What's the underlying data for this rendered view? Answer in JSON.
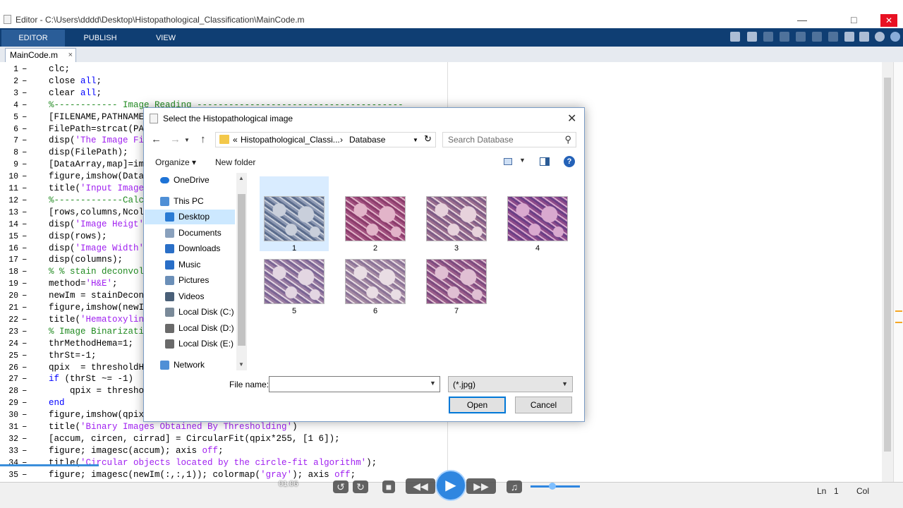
{
  "window": {
    "title": "Editor - C:\\Users\\dddd\\Desktop\\Histopathological_Classification\\MainCode.m"
  },
  "ribbon": {
    "tabs": [
      {
        "label": "EDITOR",
        "active": true
      },
      {
        "label": "PUBLISH",
        "active": false
      },
      {
        "label": "VIEW",
        "active": false
      }
    ]
  },
  "editor": {
    "file_tab": "MainCode.m",
    "lines": [
      {
        "n": "1",
        "parts": [
          [
            "clc;",
            "p"
          ]
        ]
      },
      {
        "n": "2",
        "parts": [
          [
            "close ",
            "p"
          ],
          [
            "all",
            "kw"
          ],
          [
            ";",
            "p"
          ]
        ]
      },
      {
        "n": "3",
        "parts": [
          [
            "clear ",
            "p"
          ],
          [
            "all",
            "kw"
          ],
          [
            ";",
            "p"
          ]
        ]
      },
      {
        "n": "4",
        "parts": [
          [
            "%------------ Image Reading ---------------------------------------",
            "cm"
          ]
        ]
      },
      {
        "n": "5",
        "parts": [
          [
            "[FILENAME,PATHNAME",
            "p"
          ]
        ]
      },
      {
        "n": "6",
        "parts": [
          [
            "FilePath=strcat(PA",
            "p"
          ]
        ]
      },
      {
        "n": "7",
        "parts": [
          [
            "disp(",
            "p"
          ],
          [
            "'The Image Fi",
            "str"
          ]
        ]
      },
      {
        "n": "8",
        "parts": [
          [
            "disp(FilePath);",
            "p"
          ]
        ]
      },
      {
        "n": "9",
        "parts": [
          [
            "[DataArray,map]=im",
            "p"
          ]
        ]
      },
      {
        "n": "10",
        "parts": [
          [
            "figure,imshow(Data",
            "p"
          ]
        ]
      },
      {
        "n": "11",
        "parts": [
          [
            "title(",
            "p"
          ],
          [
            "'Input Image",
            "str"
          ]
        ]
      },
      {
        "n": "12",
        "parts": [
          [
            "%-------------Calc",
            "cm"
          ]
        ]
      },
      {
        "n": "13",
        "parts": [
          [
            "[rows,columns,Ncol",
            "p"
          ]
        ]
      },
      {
        "n": "14",
        "parts": [
          [
            "disp(",
            "p"
          ],
          [
            "'Image Heigt'",
            "str"
          ]
        ]
      },
      {
        "n": "15",
        "parts": [
          [
            "disp(rows);",
            "p"
          ]
        ]
      },
      {
        "n": "16",
        "parts": [
          [
            "disp(",
            "p"
          ],
          [
            "'Image Width'",
            "str"
          ]
        ]
      },
      {
        "n": "17",
        "parts": [
          [
            "disp(columns);",
            "p"
          ]
        ]
      },
      {
        "n": "18",
        "parts": [
          [
            "% % stain deconvol",
            "cm"
          ]
        ]
      },
      {
        "n": "19",
        "parts": [
          [
            "method=",
            "p"
          ],
          [
            "'H&E'",
            "str"
          ],
          [
            ";",
            "p"
          ]
        ]
      },
      {
        "n": "20",
        "parts": [
          [
            "newIm = stainDecon",
            "p"
          ]
        ]
      },
      {
        "n": "21",
        "parts": [
          [
            "figure,imshow(newI",
            "p"
          ]
        ]
      },
      {
        "n": "22",
        "parts": [
          [
            "title(",
            "p"
          ],
          [
            "'Hematoxylin",
            "str"
          ]
        ]
      },
      {
        "n": "23",
        "parts": [
          [
            "% Image Binarizati",
            "cm"
          ]
        ]
      },
      {
        "n": "24",
        "parts": [
          [
            "thrMethodHema=1;",
            "p"
          ]
        ]
      },
      {
        "n": "25",
        "parts": [
          [
            "thrSt=-1;",
            "p"
          ]
        ]
      },
      {
        "n": "26",
        "parts": [
          [
            "qpix  = thresholdH",
            "p"
          ]
        ]
      },
      {
        "n": "27",
        "parts": [
          [
            "if",
            "kw"
          ],
          [
            " (thrSt ~= -1)",
            "p"
          ]
        ]
      },
      {
        "n": "28",
        "parts": [
          [
            "    qpix = thresho",
            "p"
          ]
        ]
      },
      {
        "n": "29",
        "parts": [
          [
            "end",
            "kw"
          ]
        ]
      },
      {
        "n": "30",
        "parts": [
          [
            "figure,imshow(qpix",
            "p"
          ]
        ]
      },
      {
        "n": "31",
        "parts": [
          [
            "title(",
            "p"
          ],
          [
            "'Binary Images Obtained By Thresholding'",
            "str"
          ],
          [
            ")",
            "p"
          ]
        ]
      },
      {
        "n": "32",
        "parts": [
          [
            "[accum, circen, cirrad] = CircularFit(qpix*255, [1 6]);",
            "p"
          ]
        ]
      },
      {
        "n": "33",
        "parts": [
          [
            "figure; imagesc(accum); axis ",
            "p"
          ],
          [
            "off",
            "str"
          ],
          [
            ";",
            "p"
          ]
        ]
      },
      {
        "n": "34",
        "parts": [
          [
            "title(",
            "p"
          ],
          [
            "'Circular objects located by the circle-fit algorithm'",
            "str"
          ],
          [
            ");",
            "p"
          ]
        ]
      },
      {
        "n": "35",
        "parts": [
          [
            "figure; imagesc(newIm(:,:,1)); colormap(",
            "p"
          ],
          [
            "'gray'",
            "str"
          ],
          [
            "); axis ",
            "p"
          ],
          [
            "off",
            "str"
          ],
          [
            ";",
            "p"
          ]
        ]
      }
    ]
  },
  "status_bar": {
    "ln_label": "Ln",
    "ln_value": "1",
    "col_label": "Col"
  },
  "player": {
    "time": "01:06"
  },
  "dialog": {
    "title": "Select the Histopathological image",
    "address": {
      "prefix": "«",
      "crumbs": [
        "Histopathological_Classi...",
        "Database"
      ]
    },
    "search_placeholder": "Search Database",
    "organize_label": "Organize ▾",
    "new_folder_label": "New folder",
    "help_label": "?",
    "nav_items": [
      {
        "label": "OneDrive",
        "icon": "onedrive-cloud-icon",
        "color": "#1e73d6",
        "indent": 1,
        "selected": false
      },
      {
        "label": "This PC",
        "icon": "this-pc-icon",
        "color": "#4f8fd6",
        "indent": 1,
        "selected": false
      },
      {
        "label": "Desktop",
        "icon": "desktop-icon",
        "color": "#2a7bd4",
        "indent": 2,
        "selected": true
      },
      {
        "label": "Documents",
        "icon": "documents-icon",
        "color": "#8aa1bd",
        "indent": 2,
        "selected": false
      },
      {
        "label": "Downloads",
        "icon": "downloads-icon",
        "color": "#2a6fc7",
        "indent": 2,
        "selected": false
      },
      {
        "label": "Music",
        "icon": "music-icon",
        "color": "#2a6fc7",
        "indent": 2,
        "selected": false
      },
      {
        "label": "Pictures",
        "icon": "pictures-icon",
        "color": "#6b8fb8",
        "indent": 2,
        "selected": false
      },
      {
        "label": "Videos",
        "icon": "videos-icon",
        "color": "#4a6078",
        "indent": 2,
        "selected": false
      },
      {
        "label": "Local Disk (C:)",
        "icon": "local-disk-c-icon",
        "color": "#7a8a99",
        "indent": 2,
        "selected": false
      },
      {
        "label": "Local Disk (D:)",
        "icon": "local-disk-d-icon",
        "color": "#6a6a6a",
        "indent": 2,
        "selected": false
      },
      {
        "label": "Local Disk (E:)",
        "icon": "local-disk-e-icon",
        "color": "#6a6a6a",
        "indent": 2,
        "selected": false
      },
      {
        "label": "Network",
        "icon": "network-icon",
        "color": "#4f8fd6",
        "indent": 1,
        "selected": false
      }
    ],
    "files": [
      {
        "label": "1",
        "selected": true,
        "tint": [
          "#5b6c8c",
          "#c9cfdb",
          "#8b97b2"
        ]
      },
      {
        "label": "2",
        "selected": false,
        "tint": [
          "#a2507f",
          "#e2b4c9",
          "#8b3c6c"
        ]
      },
      {
        "label": "3",
        "selected": false,
        "tint": [
          "#9a6d8e",
          "#e7d2dc",
          "#7d5c86"
        ]
      },
      {
        "label": "4",
        "selected": false,
        "tint": [
          "#8c4a8a",
          "#d9a9cf",
          "#6a3f86"
        ]
      },
      {
        "label": "5",
        "selected": false,
        "tint": [
          "#9a7ca2",
          "#e3d6e2",
          "#7a6594"
        ]
      },
      {
        "label": "6",
        "selected": false,
        "tint": [
          "#a58aa3",
          "#e9dde4",
          "#8a7397"
        ]
      },
      {
        "label": "7",
        "selected": false,
        "tint": [
          "#9a5c8a",
          "#e0bfd3",
          "#7c4b7f"
        ]
      }
    ],
    "file_name_label": "File name:",
    "file_name_value": "",
    "file_type_value": "(*.jpg)",
    "open_label": "Open",
    "cancel_label": "Cancel"
  }
}
